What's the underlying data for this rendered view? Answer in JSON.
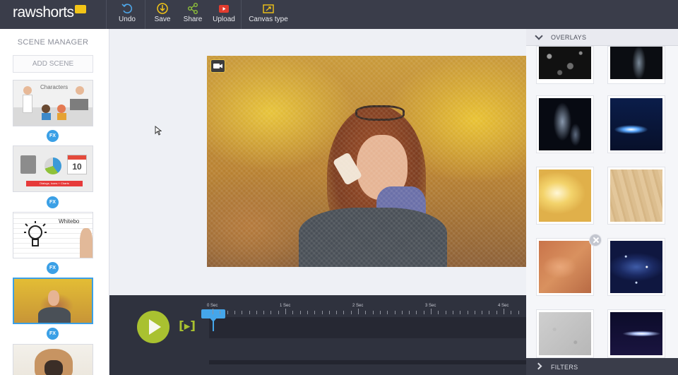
{
  "app": {
    "logo_text": "rawshorts"
  },
  "toolbar": {
    "undo_label": "Undo",
    "save_label": "Save",
    "share_label": "Share",
    "upload_label": "Upload",
    "canvas_type_label": "Canvas type"
  },
  "scene_manager": {
    "title": "SCENE MANAGER",
    "add_scene_label": "ADD SCENE",
    "fx_label": "FX",
    "scenes": [
      {
        "thumb_text": "Characters",
        "selected": false
      },
      {
        "thumb_text": "10",
        "thumb_caption": "Dialogs, Icons + Charts",
        "selected": false
      },
      {
        "thumb_text": "Whitebo",
        "selected": false
      },
      {
        "thumb_text": "",
        "selected": true
      },
      {
        "thumb_text": "",
        "selected": false
      }
    ]
  },
  "timeline": {
    "time_labels": [
      "0 Sec",
      "1 Sec",
      "2 Sec",
      "3 Sec",
      "4 Sec"
    ],
    "playhead_time_sec": 0
  },
  "overlays": {
    "title": "OVERLAYS",
    "tiles": [
      "bokeh-dark",
      "smoke-dark",
      "smoke-blue",
      "lens-flare-blue",
      "light-leak-yellow",
      "wood-texture",
      "rust-texture",
      "galaxy-stars",
      "concrete-texture",
      "flare-dark"
    ]
  },
  "filters": {
    "title": "FILTERS"
  },
  "colors": {
    "toolbar_bg": "#3a3d4a",
    "accent_blue": "#3ba0e6",
    "play_green": "#a9c130",
    "logo_yellow": "#f3c517"
  }
}
